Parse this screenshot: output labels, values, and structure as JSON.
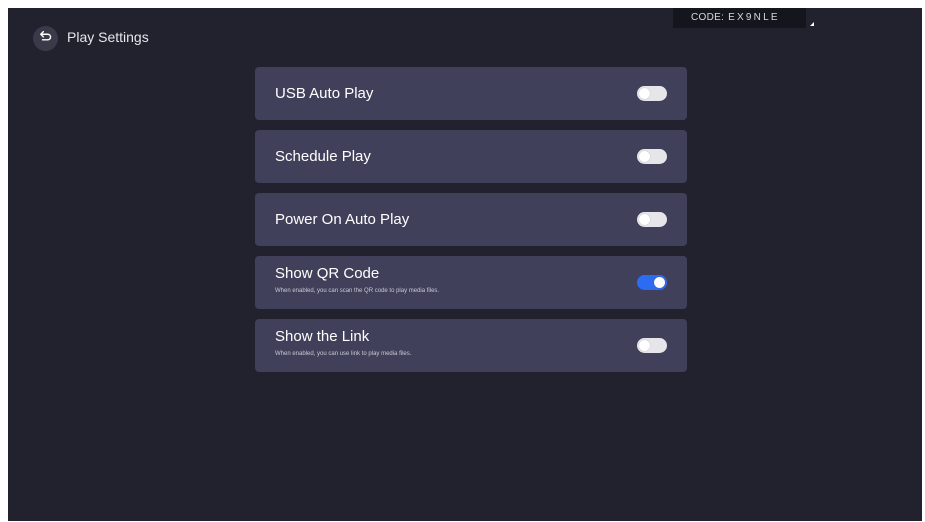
{
  "header": {
    "title": "Play Settings",
    "back_icon": "back-arrow-icon"
  },
  "code_badge": {
    "prefix": "CODE:",
    "code": "EX9NLE"
  },
  "settings": [
    {
      "label": "USB Auto Play",
      "description": "",
      "enabled": false
    },
    {
      "label": "Schedule Play",
      "description": "",
      "enabled": false
    },
    {
      "label": "Power On Auto Play",
      "description": "",
      "enabled": false
    },
    {
      "label": "Show QR Code",
      "description": "When enabled, you can scan the QR code to play media files.",
      "enabled": true
    },
    {
      "label": "Show the Link",
      "description": "When enabled, you can use link to play media files.",
      "enabled": false
    }
  ],
  "colors": {
    "background": "#22222f",
    "card": "#41405a",
    "toggle_on": "#2d6cf2",
    "toggle_off": "#e6e6ea"
  }
}
